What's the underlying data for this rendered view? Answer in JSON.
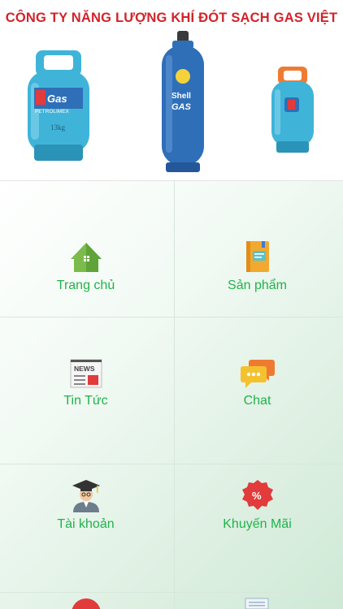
{
  "banner": {
    "title": "CÔNG TY NĂNG LƯỢNG KHÍ ĐÓT SẠCH GAS VIỆT",
    "cylinder_left": {
      "brand": "Gas",
      "sub": "PETROLIMEX",
      "weight": "13kg"
    },
    "cylinder_center": {
      "brand": "Shell",
      "sub": "GAS"
    }
  },
  "menu": {
    "items": [
      {
        "label": "Trang chủ",
        "icon": "home-icon"
      },
      {
        "label": "Sản phẩm",
        "icon": "notebook-icon"
      },
      {
        "label": "Tin Tức",
        "icon": "news-icon"
      },
      {
        "label": "Chat",
        "icon": "chat-bubbles-icon"
      },
      {
        "label": "Tài khoản",
        "icon": "graduate-user-icon"
      },
      {
        "label": "Khuyến Mãi",
        "icon": "discount-badge-icon"
      }
    ]
  },
  "colors": {
    "title_red": "#d2232a",
    "label_green": "#21b24b",
    "cylinder_teal": "#3fb4d8",
    "cylinder_blue": "#2f6fb8"
  }
}
